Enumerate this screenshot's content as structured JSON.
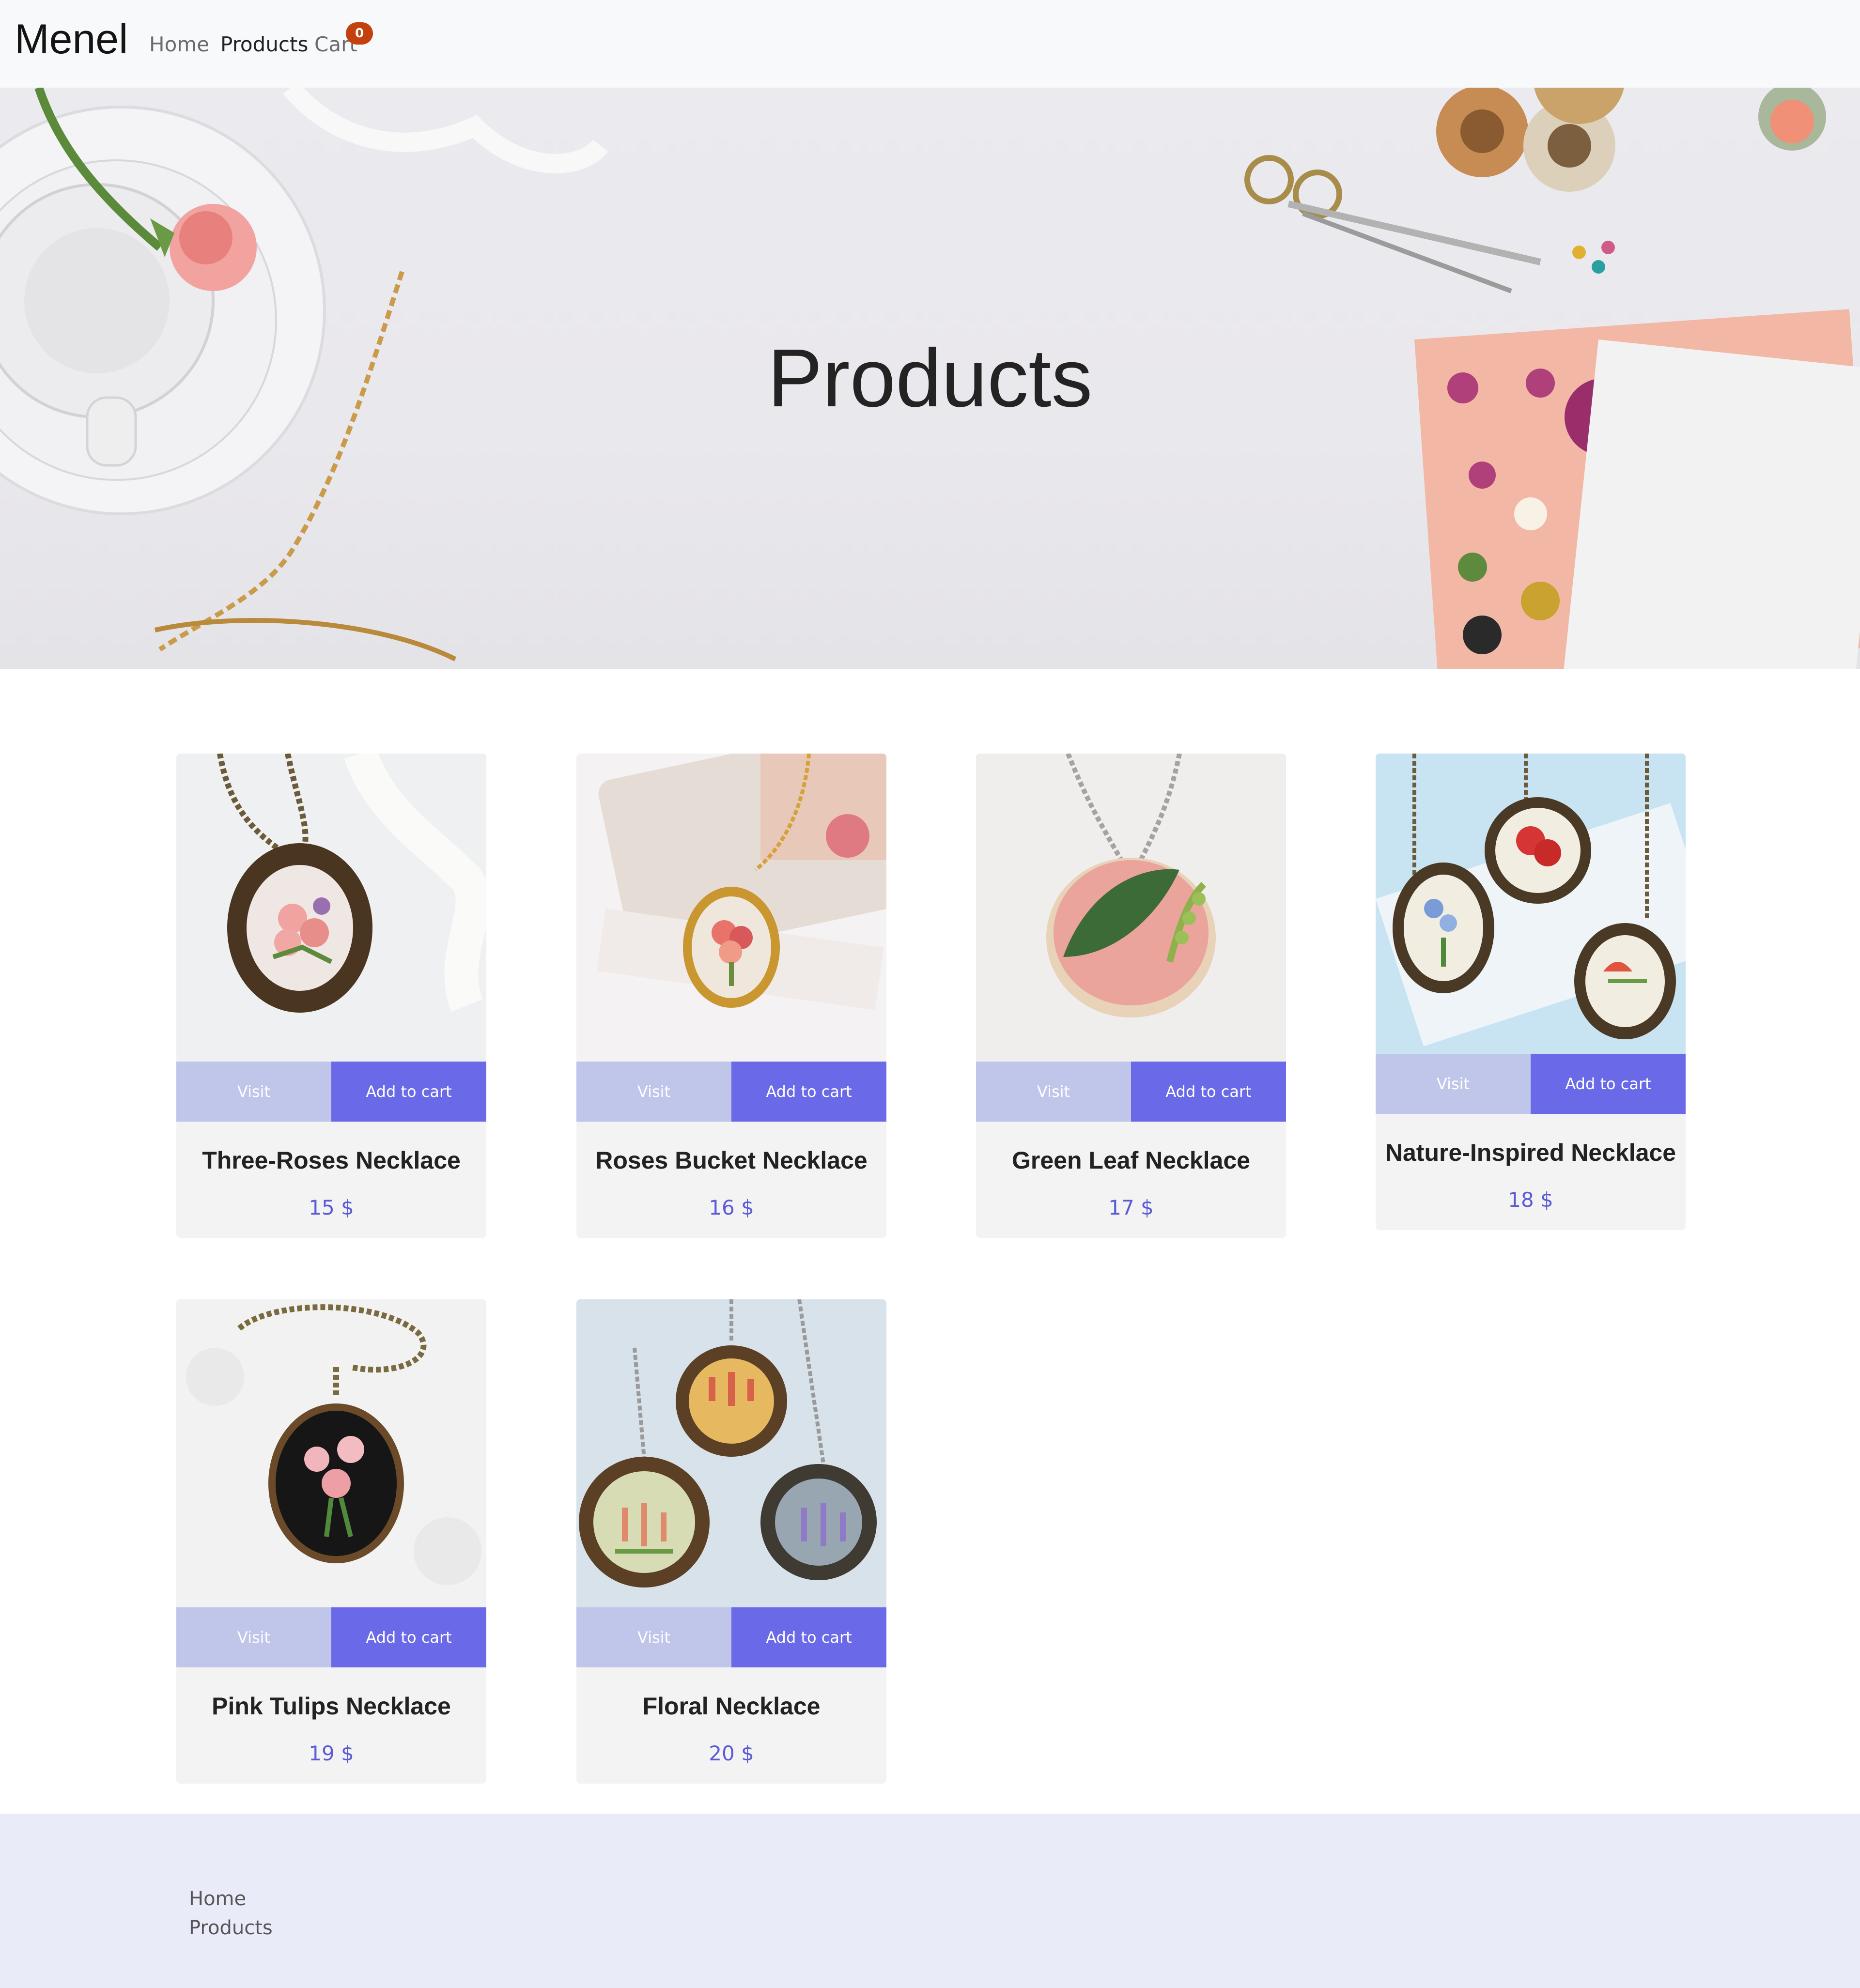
{
  "nav": {
    "brand": "Menel",
    "links": [
      "Home",
      "Products",
      "Cart"
    ],
    "active": "Products",
    "cart_count": "0"
  },
  "hero": {
    "title": "Products"
  },
  "products": [
    {
      "name": "Three-Roses Necklace",
      "price": "15 $",
      "visit_label": "Visit",
      "add_label": "Add to cart"
    },
    {
      "name": "Roses Bucket Necklace",
      "price": "16 $",
      "visit_label": "Visit",
      "add_label": "Add to cart"
    },
    {
      "name": "Green Leaf Necklace",
      "price": "17 $",
      "visit_label": "Visit",
      "add_label": "Add to cart"
    },
    {
      "name": "Nature-Inspired Necklace",
      "price": "18 $",
      "visit_label": "Visit",
      "add_label": "Add to cart"
    },
    {
      "name": "Pink Tulips Necklace",
      "price": "19 $",
      "visit_label": "Visit",
      "add_label": "Add to cart"
    },
    {
      "name": "Floral Necklace",
      "price": "20 $",
      "visit_label": "Visit",
      "add_label": "Add to cart"
    }
  ],
  "footer": {
    "links": [
      "Home",
      "Products"
    ]
  },
  "colors": {
    "accent": "#6a6ae8",
    "visit": "#bfc6ea",
    "price": "#5b5bd6",
    "badge": "#c2410c",
    "footer_bg": "#e9ebf8"
  }
}
